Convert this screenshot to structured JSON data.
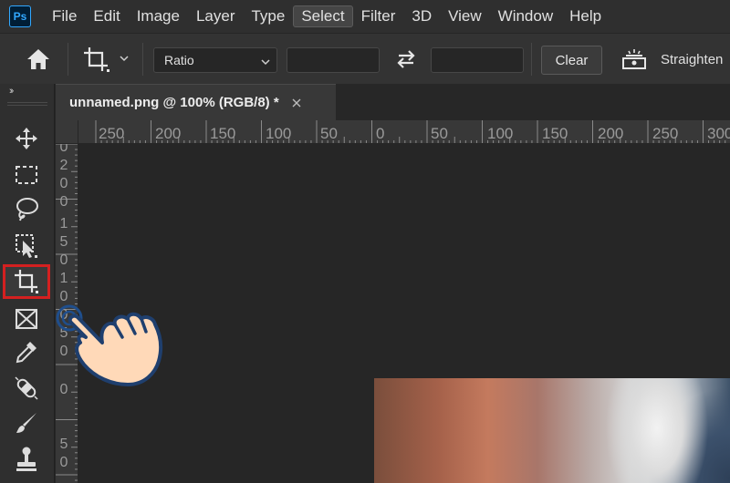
{
  "app": {
    "logo": "Ps"
  },
  "menu": {
    "items": [
      "File",
      "Edit",
      "Image",
      "Layer",
      "Type",
      "Select",
      "Filter",
      "3D",
      "View",
      "Window",
      "Help"
    ],
    "active_index": 5
  },
  "options": {
    "ratio_label": "Ratio",
    "width_value": "",
    "height_value": "",
    "clear_label": "Clear",
    "straighten_label": "Straighten"
  },
  "toolbar": {
    "collapse_glyph": "››",
    "tools": [
      {
        "name": "move-tool",
        "icon": "move-icon"
      },
      {
        "name": "marquee-tool",
        "icon": "rectangular-marquee-icon"
      },
      {
        "name": "lasso-tool",
        "icon": "lasso-icon"
      },
      {
        "name": "object-selection-tool",
        "icon": "object-selection-icon"
      },
      {
        "name": "crop-tool",
        "icon": "crop-icon",
        "selected": true
      },
      {
        "name": "frame-tool",
        "icon": "frame-icon"
      },
      {
        "name": "eyedropper-tool",
        "icon": "eyedropper-icon"
      },
      {
        "name": "healing-brush-tool",
        "icon": "bandage-icon"
      },
      {
        "name": "brush-tool",
        "icon": "brush-icon"
      },
      {
        "name": "clone-stamp-tool",
        "icon": "stamp-icon"
      }
    ],
    "selected_color": "#d42020"
  },
  "document": {
    "tab_title": "unnamed.png @ 100% (RGB/8) *",
    "close_glyph": "×"
  },
  "ruler": {
    "horizontal_labels": [
      "250",
      "200",
      "150",
      "100",
      "50",
      "0",
      "50",
      "100",
      "150",
      "200",
      "250",
      "300"
    ],
    "vertical_labels": [
      "0",
      "2",
      "0",
      "0",
      "1",
      "5",
      "0",
      "1",
      "0",
      "0",
      "5",
      "0",
      "0",
      "5",
      "0"
    ]
  },
  "colors": {
    "accent": "#31a8ff",
    "highlight_red": "#d42020",
    "panel": "#2f2f2f",
    "canvas": "#262626"
  }
}
